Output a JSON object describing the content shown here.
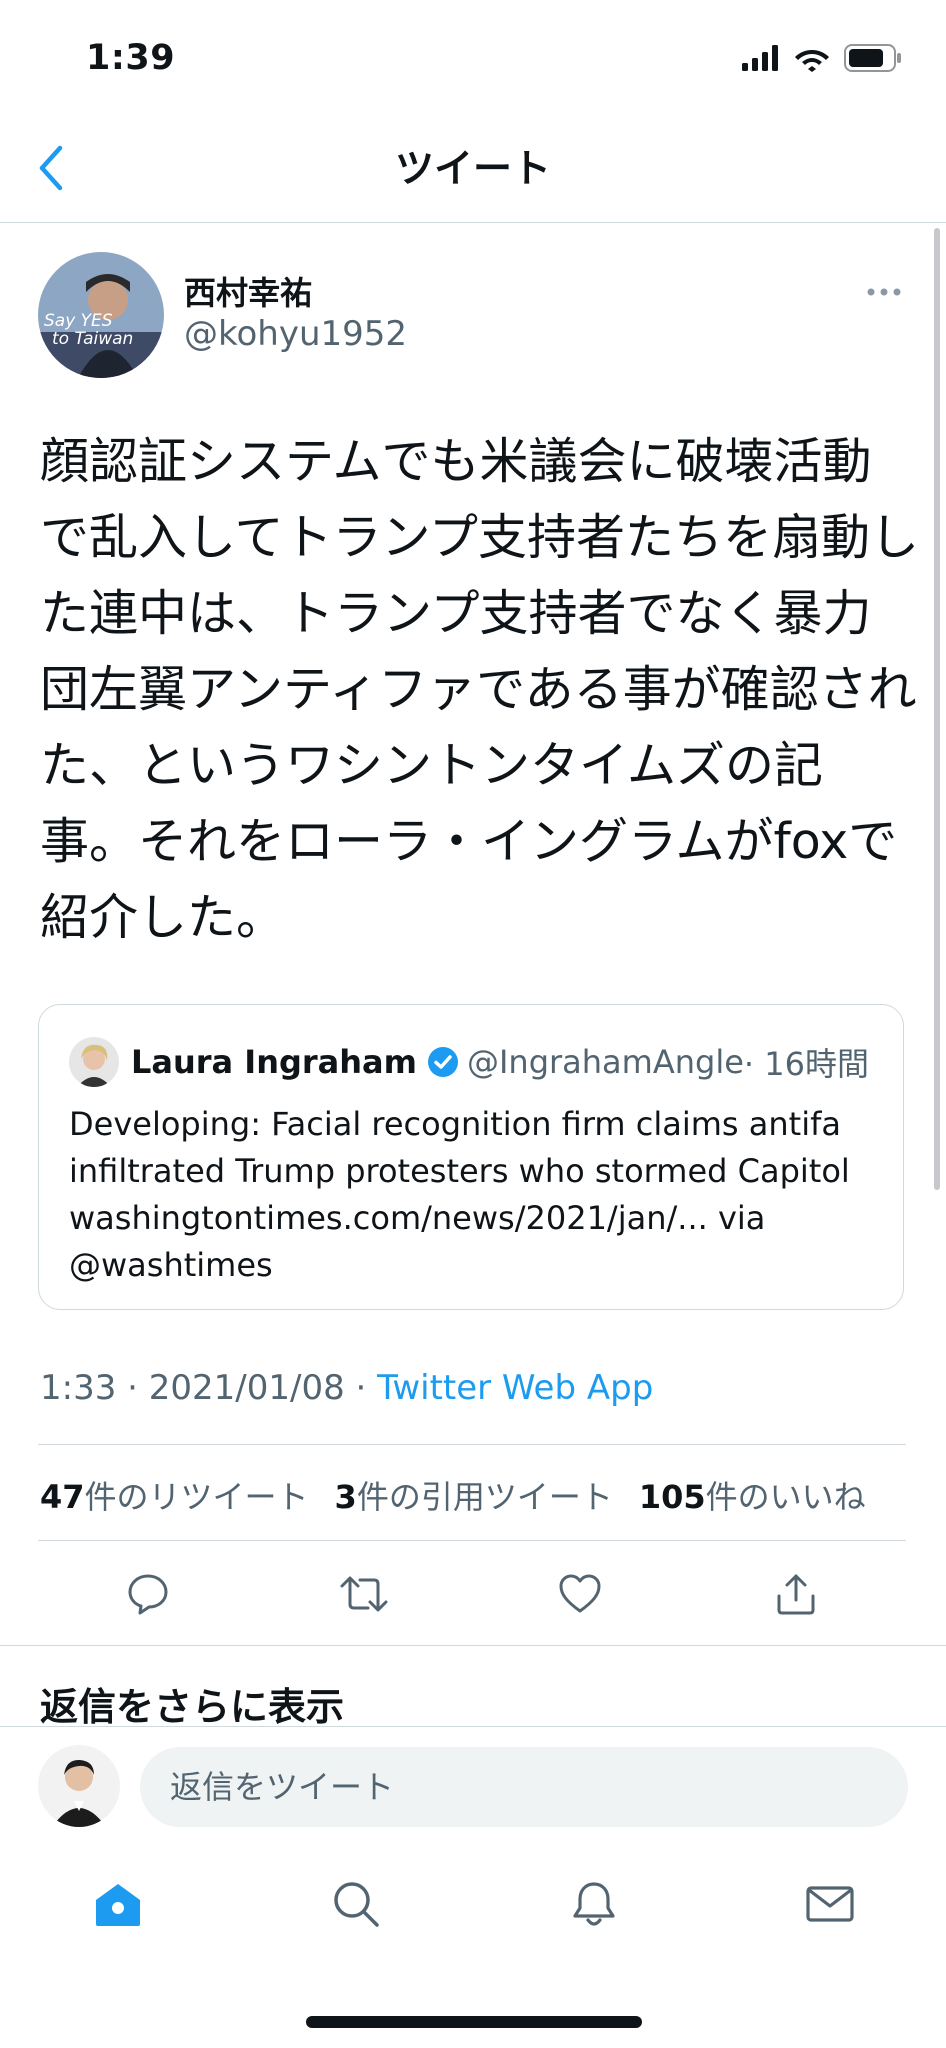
{
  "status_bar": {
    "time": "1:39",
    "icons": [
      "cellular-signal-icon",
      "wifi-icon",
      "battery-icon"
    ]
  },
  "nav": {
    "back_icon": "chevron-left-icon",
    "title": "ツイート"
  },
  "tweet": {
    "author_name": "西村幸祐",
    "author_handle": "@kohyu1952",
    "avatar_caption_1": "Say YES",
    "avatar_caption_2": "to Taiwan",
    "more_icon": "more-horizontal-icon",
    "body": "顔認証システムでも米議会に破壊活動で乱入してトランプ支持者たちを扇動した連中は、トランプ支持者でなく暴力団左翼アンティファである事が確認された、というワシントンタイムズの記事。それをローラ・イングラムがfoxで紹介した。",
    "quote": {
      "name": "Laura Ingraham",
      "verified_icon": "verified-badge-icon",
      "handle": "@IngrahamAngle",
      "time": "· 16時間",
      "text": "Developing: Facial recognition firm claims antifa infiltrated Trump protesters who stormed Capitol washingtontimes.com/news/2021/jan/... via @washtimes"
    },
    "time": "1:33 · 2021/01/08 · ",
    "source": "Twitter Web App",
    "stats": {
      "retweets_count": "47",
      "retweets_label": "件のリツイート",
      "quotes_count": "3",
      "quotes_label": "件の引用ツイート",
      "likes_count": "105",
      "likes_label": "件のいいね"
    },
    "actions": [
      "reply-icon",
      "retweet-icon",
      "like-icon",
      "share-icon"
    ]
  },
  "more_replies": "返信をさらに表示",
  "reply_bar": {
    "placeholder": "返信をツイート"
  },
  "tab_bar": {
    "tabs": [
      "home-icon",
      "search-icon",
      "notifications-icon",
      "messages-icon"
    ],
    "active_color": "#1d9bf0"
  },
  "colors": {
    "accent": "#1d9bf0",
    "text": "#0f1419",
    "secondary": "#536471",
    "border": "#cfd9de"
  }
}
